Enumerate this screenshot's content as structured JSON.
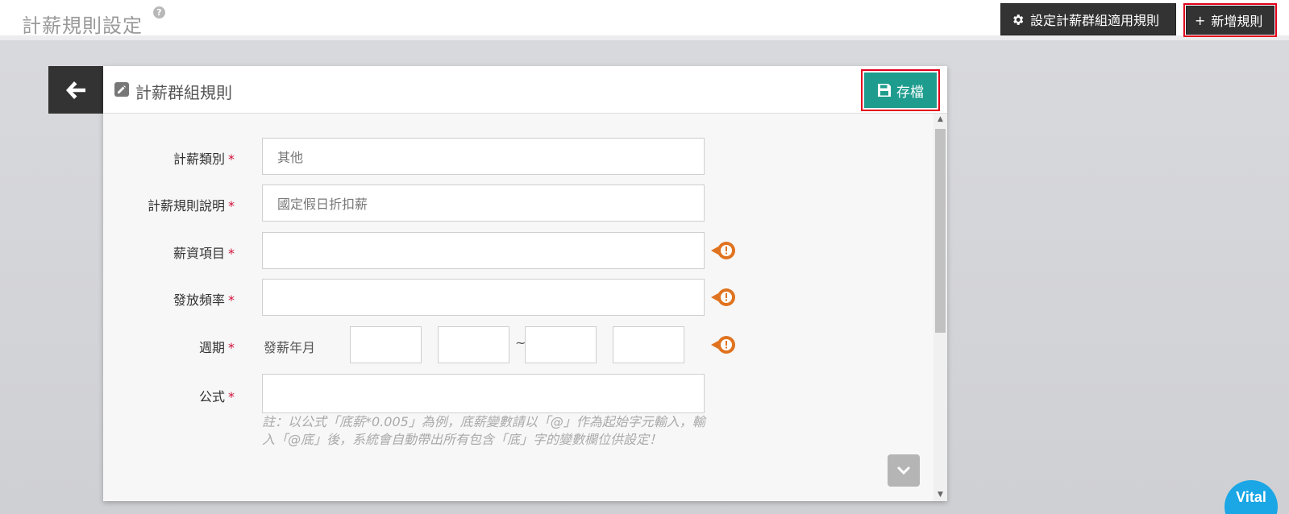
{
  "header": {
    "title": "計薪規則設定",
    "help_icon": "?",
    "group_rule_button": "設定計薪群組適用規則",
    "add_rule_button": "新增規則",
    "add_rule_icon": "+"
  },
  "card": {
    "title": "計薪群組規則",
    "save_button": "存檔"
  },
  "form": {
    "required_mark": "*",
    "pay_category": {
      "label": "計薪類別",
      "value": "其他"
    },
    "rule_description": {
      "label": "計薪規則說明",
      "value": "國定假日折扣薪"
    },
    "salary_item": {
      "label": "薪資項目",
      "value": ""
    },
    "pay_frequency": {
      "label": "發放頻率",
      "value": ""
    },
    "period": {
      "label": "週期",
      "prefix": "發薪年月",
      "separator": "~",
      "from_year": "",
      "from_month": "",
      "to_year": "",
      "to_month": ""
    },
    "formula": {
      "label": "公式",
      "value": ""
    },
    "note": "註：以公式「底薪*0.005」為例，底薪變數請以「@」作為起始字元輸入，輸入「@底」後，系統會自動帶出所有包含「底」字的變數欄位供設定！"
  },
  "colors": {
    "primary": "#1e9d8e",
    "dark": "#333333",
    "required": "#d0103a",
    "warning": "#e0731f",
    "highlight_frame": "#e0001b",
    "logo": "#1ba6e5"
  },
  "icons": [
    "help-icon",
    "gear-icon",
    "plus-icon",
    "arrow-left-icon",
    "edit-icon",
    "floppy-disk-icon",
    "warning-icon",
    "chevron-down-icon"
  ],
  "logo_text": "Vital"
}
